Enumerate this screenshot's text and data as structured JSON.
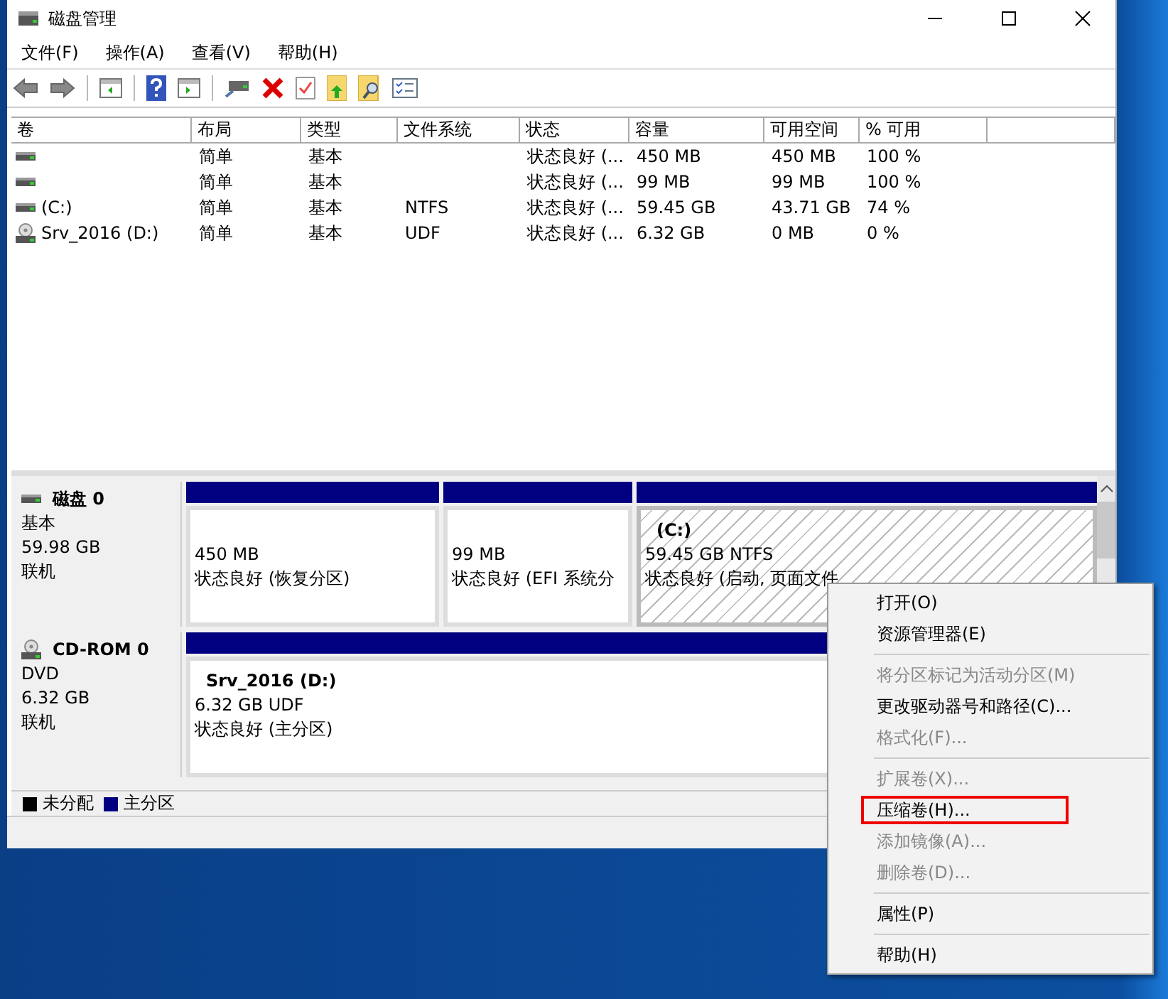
{
  "window": {
    "title": "磁盘管理"
  },
  "menu": [
    "文件(F)",
    "操作(A)",
    "查看(V)",
    "帮助(H)"
  ],
  "table": {
    "columns": [
      "卷",
      "布局",
      "类型",
      "文件系统",
      "状态",
      "容量",
      "可用空间",
      "% 可用"
    ],
    "rows": [
      {
        "kind": "disk",
        "cells": [
          "",
          "简单",
          "基本",
          "",
          "状态良好 (...",
          "450 MB",
          "450 MB",
          "100 %"
        ]
      },
      {
        "kind": "disk",
        "cells": [
          "",
          "简单",
          "基本",
          "",
          "状态良好 (...",
          "99 MB",
          "99 MB",
          "100 %"
        ]
      },
      {
        "kind": "disk",
        "cells": [
          "(C:)",
          "简单",
          "基本",
          "NTFS",
          "状态良好 (...",
          "59.45 GB",
          "43.71 GB",
          "74 %"
        ]
      },
      {
        "kind": "cd",
        "cells": [
          "Srv_2016 (D:)",
          "简单",
          "基本",
          "UDF",
          "状态良好 (...",
          "6.32 GB",
          "0 MB",
          "0 %"
        ]
      }
    ]
  },
  "disks": [
    {
      "kind": "disk",
      "name": "磁盘 0",
      "type": "基本",
      "size": "59.98 GB",
      "state": "联机",
      "partitions": [
        {
          "size": "450 MB",
          "status": "状态良好 (恢复分区)",
          "selected": false
        },
        {
          "size": "99 MB",
          "status": "状态良好 (EFI 系统分",
          "selected": false
        },
        {
          "label": "(C:)",
          "size": "59.45 GB NTFS",
          "status": "状态良好 (启动, 页面文件",
          "selected": true
        }
      ]
    },
    {
      "kind": "cd",
      "name": "CD-ROM 0",
      "type": "DVD",
      "size": "6.32 GB",
      "state": "联机",
      "partitions": [
        {
          "label": "Srv_2016  (D:)",
          "size": "6.32 GB UDF",
          "status": "状态良好 (主分区)",
          "selected": false
        }
      ]
    }
  ],
  "legend": [
    {
      "label": "未分配",
      "color": "#000000"
    },
    {
      "label": "主分区",
      "color": "#000080"
    }
  ],
  "context_menu": [
    {
      "kind": "item",
      "label": "打开(O)",
      "disabled": false,
      "highlighted": false
    },
    {
      "kind": "item",
      "label": "资源管理器(E)",
      "disabled": false,
      "highlighted": false
    },
    {
      "kind": "separator"
    },
    {
      "kind": "item",
      "label": "将分区标记为活动分区(M)",
      "disabled": true,
      "highlighted": false
    },
    {
      "kind": "item",
      "label": "更改驱动器号和路径(C)...",
      "disabled": false,
      "highlighted": false
    },
    {
      "kind": "item",
      "label": "格式化(F)...",
      "disabled": true,
      "highlighted": false
    },
    {
      "kind": "separator"
    },
    {
      "kind": "item",
      "label": "扩展卷(X)...",
      "disabled": true,
      "highlighted": false
    },
    {
      "kind": "item",
      "label": "压缩卷(H)...",
      "disabled": false,
      "highlighted": true
    },
    {
      "kind": "item",
      "label": "添加镜像(A)...",
      "disabled": true,
      "highlighted": false
    },
    {
      "kind": "item",
      "label": "删除卷(D)...",
      "disabled": true,
      "highlighted": false
    },
    {
      "kind": "separator"
    },
    {
      "kind": "item",
      "label": "属性(P)",
      "disabled": false,
      "highlighted": false
    },
    {
      "kind": "separator"
    },
    {
      "kind": "item",
      "label": "帮助(H)",
      "disabled": false,
      "highlighted": false
    }
  ]
}
